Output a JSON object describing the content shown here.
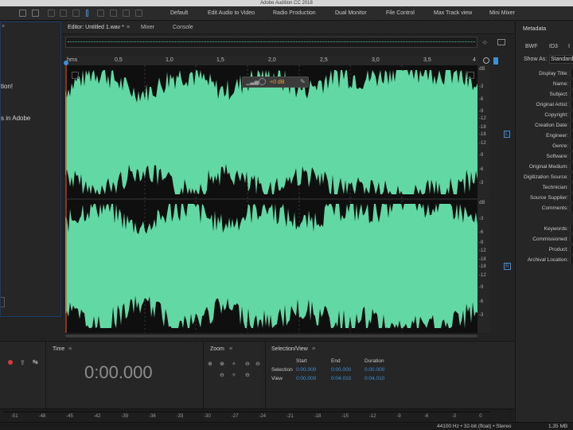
{
  "app": {
    "title": "Adobe Audition CC 2018"
  },
  "workspaces": [
    "Default",
    "Edit Audio to Video",
    "Radio Production",
    "Dual Monitor",
    "File Control",
    "Max Track view",
    "Mini Mixer"
  ],
  "left_panel": {
    "lines": [
      "tion!",
      "s in Adobe"
    ]
  },
  "editor": {
    "tabs": [
      "Editor: Untitled 1.wav *",
      "Mixer",
      "Console"
    ],
    "ruler": [
      "hms",
      "0,5",
      "1,0",
      "1,5",
      "2,0",
      "2,5",
      "3,0",
      "3,5",
      "4"
    ],
    "hud_gain": "+0 dB",
    "db_labels_top": [
      "dB",
      "-3",
      "-6",
      "-9",
      "-12",
      "-18",
      "-18",
      "-12",
      "-9",
      "-6",
      "-3"
    ],
    "db_labels_bottom": [
      "dB",
      "-3",
      "-6",
      "-9",
      "-12",
      "-18",
      "-18",
      "-12",
      "-9",
      "-6",
      "-3"
    ],
    "channel_top": "L",
    "channel_bottom": "R",
    "wave_color": "#62d8a4"
  },
  "time_panel": {
    "title": "Time",
    "value": "0:00.000"
  },
  "zoom_panel": {
    "title": "Zoom"
  },
  "selection_panel": {
    "title": "Selection/View",
    "headers": [
      "Start",
      "End",
      "Duration"
    ],
    "rows": [
      {
        "label": "Selection",
        "start": "0:00.000",
        "end": "0:00.000",
        "duration": "0:00.000"
      },
      {
        "label": "View",
        "start": "0:00.000",
        "end": "0:04.010",
        "duration": "0:04.010"
      }
    ]
  },
  "meter": {
    "labels": [
      "-51",
      "-48",
      "-45",
      "-42",
      "-39",
      "-36",
      "-33",
      "-30",
      "-27",
      "-24",
      "-21",
      "-18",
      "-15",
      "-12",
      "-9",
      "-6",
      "-3",
      "0"
    ]
  },
  "status": {
    "format": "44100 Hz • 32-bit (float) • Stereo",
    "size": "1,35 MB"
  },
  "metadata": {
    "title": "Metadata",
    "tabs": [
      "BWF",
      "ID3",
      "I"
    ],
    "show_as_label": "Show As:",
    "show_as_value": "Standard",
    "fields": [
      "Display Title:",
      "Name:",
      "Subject:",
      "Original Artist:",
      "Copyright:",
      "Creation Date:",
      "Engineer:",
      "Genre:",
      "Software:",
      "Original Medium:",
      "Digitization Source:",
      "Technician:",
      "Source Supplier:",
      "Comments:",
      "Keywords:",
      "Commissioned:",
      "Product:",
      "Archival Location:"
    ]
  }
}
